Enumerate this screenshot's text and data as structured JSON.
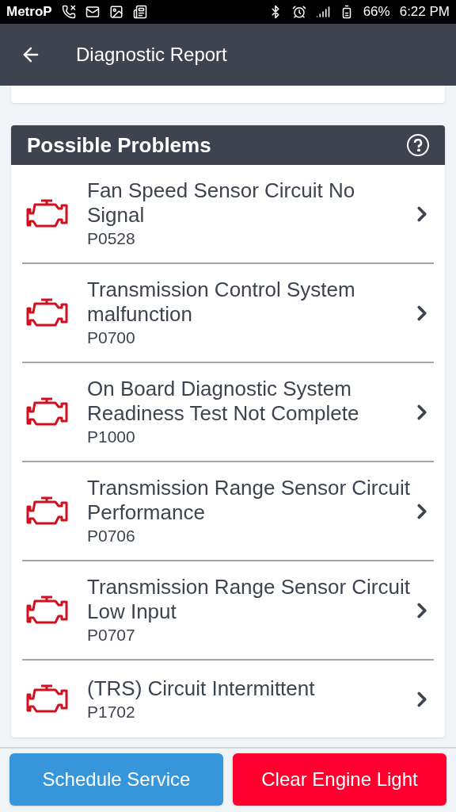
{
  "status_bar": {
    "carrier": "MetroP",
    "battery": "66%",
    "time": "6:22 PM"
  },
  "header": {
    "title": "Diagnostic Report"
  },
  "panel": {
    "title": "Possible Problems",
    "problems": [
      {
        "title": "Fan Speed Sensor Circuit No Signal",
        "code": "P0528"
      },
      {
        "title": "Transmission Control System malfunction",
        "code": "P0700"
      },
      {
        "title": "On Board Diagnostic System Readiness Test Not Complete",
        "code": "P1000"
      },
      {
        "title": "Transmission Range Sensor Circuit Performance",
        "code": "P0706"
      },
      {
        "title": "Transmission Range Sensor Circuit Low Input",
        "code": "P0707"
      },
      {
        "title": "(TRS) Circuit Intermittent",
        "code": "P1702"
      }
    ]
  },
  "buttons": [
    {
      "label": "Schedule Service",
      "kind": "primary"
    },
    {
      "label": "Clear Engine Light",
      "kind": "danger"
    }
  ]
}
